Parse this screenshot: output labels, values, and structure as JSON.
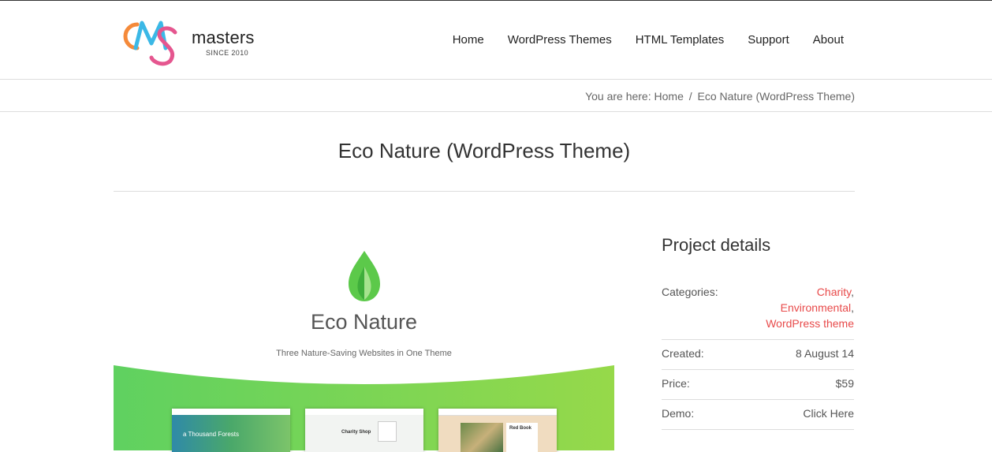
{
  "brand": {
    "name": "masters",
    "since": "SINCE 2010",
    "logo_letters": "CMS"
  },
  "nav": {
    "items": [
      "Home",
      "WordPress Themes",
      "HTML Templates",
      "Support",
      "About"
    ]
  },
  "breadcrumb": {
    "prefix": "You are here:",
    "home": "Home",
    "separator": "/",
    "current": "Eco Nature (WordPress Theme)"
  },
  "page": {
    "title": "Eco Nature (WordPress Theme)"
  },
  "hero": {
    "name": "Eco Nature",
    "tagline": "Three Nature-Saving Websites in One Theme",
    "mock_texts": [
      "a Thousand Forests",
      "Charity Shop",
      "Red Book"
    ]
  },
  "project": {
    "heading": "Project details",
    "categories_label": "Categories:",
    "categories": [
      "Charity",
      "Environmental",
      "WordPress theme"
    ],
    "created_label": "Created:",
    "created": "8 August 14",
    "price_label": "Price:",
    "price": "$59",
    "demo_label": "Demo:",
    "demo": "Click Here"
  },
  "colors": {
    "accent": "#e84a4a",
    "leaf": "#5cc94a",
    "green_band": "#74d44f"
  }
}
